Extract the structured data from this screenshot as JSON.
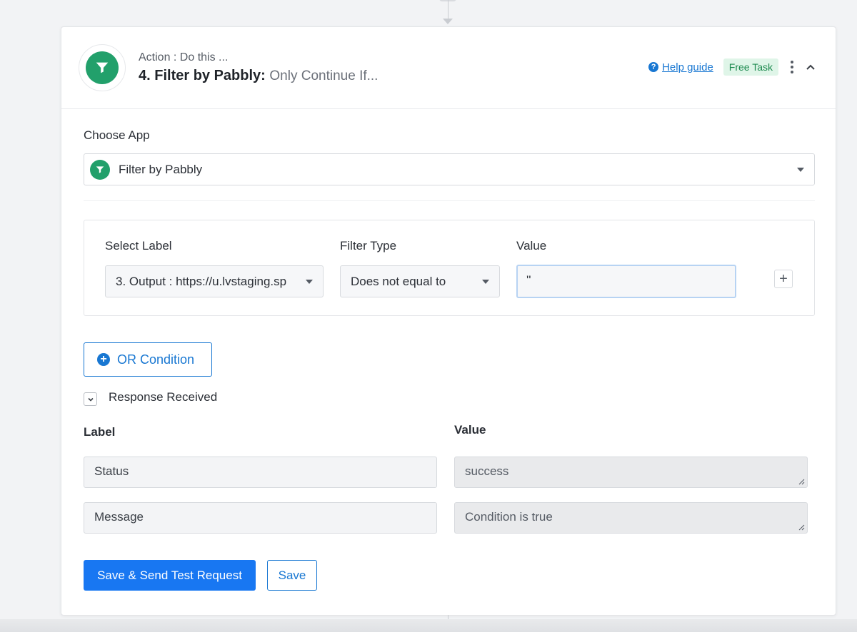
{
  "header": {
    "subtitle": "Action : Do this ...",
    "title_main": "4. Filter by Pabbly:",
    "title_rest": "Only Continue If...",
    "help_label": "Help guide",
    "badge_label": "Free Task"
  },
  "choose_app": {
    "label": "Choose App",
    "selected": "Filter by Pabbly"
  },
  "filter": {
    "label_col": "Select Label",
    "type_col": "Filter Type",
    "value_col": "Value",
    "label_value": "3. Output : https://u.lvstaging.sp",
    "type_value": "Does not equal to",
    "value_value": "''"
  },
  "or_condition_label": "OR Condition",
  "response": {
    "title": "Response Received",
    "label_head": "Label",
    "value_head": "Value",
    "rows": [
      {
        "label": "Status",
        "value": "success"
      },
      {
        "label": "Message",
        "value": "Condition is true"
      }
    ]
  },
  "actions": {
    "save_send_label": "Save & Send Test Request",
    "save_label": "Save"
  },
  "colors": {
    "accent": "#1877f2",
    "brand_green": "#22a06b",
    "badge_bg": "#dff5e8"
  },
  "icons": {
    "app": "filter-funnel-icon",
    "help": "question-circle-icon",
    "more": "kebab-menu-icon",
    "collapse": "chevron-up-icon",
    "add": "plus-icon",
    "or": "plus-circle-icon",
    "toggle": "chevron-down-icon"
  }
}
